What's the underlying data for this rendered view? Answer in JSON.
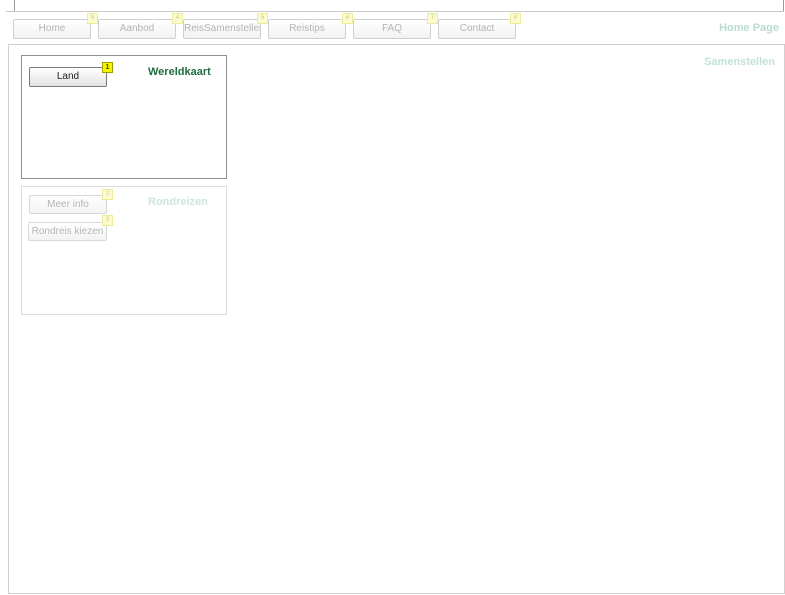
{
  "nav": {
    "items": [
      {
        "label": "Home",
        "badge": "9"
      },
      {
        "label": "Aanbod",
        "badge": "4"
      },
      {
        "label": "ReisSamenstellen",
        "badge": "5"
      },
      {
        "label": "Reistips",
        "badge": "6"
      },
      {
        "label": "FAQ",
        "badge": "7"
      },
      {
        "label": "Contact",
        "badge": "8"
      }
    ],
    "page_label": "Home Page"
  },
  "main": {
    "title": "Samenstellen",
    "panels": [
      {
        "title": "Wereldkaart",
        "buttons": [
          {
            "label": "Land",
            "badge": "1"
          }
        ]
      },
      {
        "title": "Rondreizen",
        "buttons": [
          {
            "label": "Meer info",
            "badge": "2"
          },
          {
            "label": "Rondreis kiezen",
            "badge": "3"
          }
        ]
      }
    ]
  },
  "colors": {
    "accent_green": "#1f6e3c",
    "faded_green": "#c3e2d6",
    "badge_active": "#f3f300",
    "badge_inactive": "#fbfbcf"
  }
}
